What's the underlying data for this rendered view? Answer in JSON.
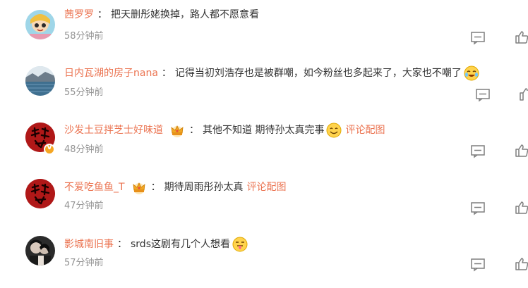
{
  "comments": [
    {
      "username": "茜罗罗",
      "separator": "：",
      "text": "把天删彤姥换掉，路人都不愿意看",
      "time": "58分钟前",
      "avatar": "cartoon-girl-avatar"
    },
    {
      "username": "日内瓦湖的房子nana",
      "separator": "：",
      "text": "记得当初刘浩存也是被群嘲，如今粉丝也多起来了，大家也不嘲了",
      "time": "55分钟前",
      "avatar": "lake-avatar",
      "emoji": "crying-laughing-emoji"
    },
    {
      "username": "沙发土豆拌芝士好味道",
      "separator": "：",
      "text": "其他不知道 期待孙太真完事",
      "pic_link": "评论配图",
      "time": "48分钟前",
      "avatar": "red-calligraphy-avatar",
      "emoji": "smile-emoji",
      "badge": "crown-badge-icon",
      "verified": "V"
    },
    {
      "username": "不爱吃鱼鱼_T",
      "separator": "：",
      "text": "期待周雨彤孙太真",
      "pic_link": "评论配图",
      "time": "47分钟前",
      "avatar": "red-calligraphy-avatar",
      "badge": "crown-badge-icon"
    },
    {
      "username": "影城南旧事",
      "separator": "：",
      "text": "srds这剧有几个人想看",
      "time": "57分钟前",
      "avatar": "couple-avatar",
      "emoji": "tongue-out-emoji"
    }
  ],
  "colors": {
    "username": "#eb7350",
    "time": "#939393",
    "icon": "#7f7f7f"
  }
}
